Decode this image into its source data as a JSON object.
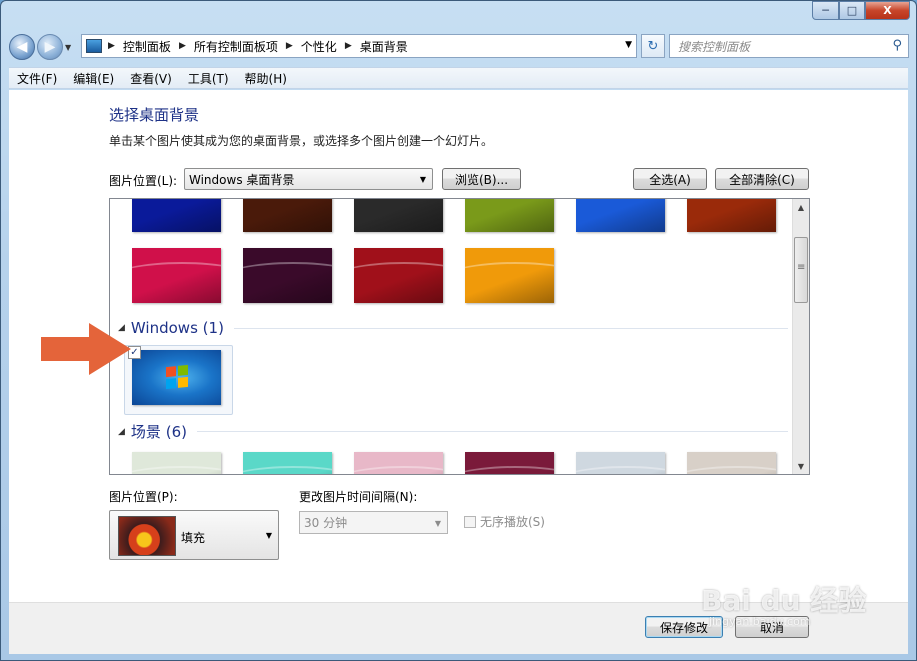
{
  "window": {
    "controls": {
      "minimize": "─",
      "maximize": "□",
      "close": "X"
    }
  },
  "nav": {
    "breadcrumbs": [
      "控制面板",
      "所有控制面板项",
      "个性化",
      "桌面背景"
    ],
    "search_placeholder": "搜索控制面板"
  },
  "menu": [
    "文件(F)",
    "编辑(E)",
    "查看(V)",
    "工具(T)",
    "帮助(H)"
  ],
  "main": {
    "title": "选择桌面背景",
    "description": "单击某个图片使其成为您的桌面背景，或选择多个图片创建一个幻灯片。",
    "location_label": "图片位置(L):",
    "location_value": "Windows 桌面背景",
    "browse_button": "浏览(B)...",
    "select_all_button": "全选(A)",
    "clear_all_button": "全部清除(C)"
  },
  "gallery": {
    "solid_colors": {
      "row1": [
        "#0a1a9a",
        "#4a1a0a",
        "#2a2a2a",
        "#7a9a1a",
        "#1a5ad8",
        "#9a2a0a"
      ],
      "row2": [
        "#d0104a",
        "#3a0a2a",
        "#a0101a",
        "#f09a0a"
      ]
    },
    "groups": [
      {
        "name": "Windows",
        "count": "(1)"
      },
      {
        "name": "场景",
        "count": "(6)"
      }
    ],
    "windows_item_checked": "✓",
    "scene_colors": [
      "#dfe8da",
      "#5ad8c8",
      "#e8b8c8",
      "#7a1a3a",
      "#cfd8e0",
      "#d8d0c8"
    ]
  },
  "bottom": {
    "position_label": "图片位置(P):",
    "position_value": "填充",
    "interval_label": "更改图片时间间隔(N):",
    "interval_value": "30 分钟",
    "shuffle_label": "无序播放(S)"
  },
  "footer": {
    "save_button": "保存修改",
    "cancel_button": "取消"
  },
  "watermark": {
    "text": "Bai du 经验",
    "sub": "jingyan.baidu.com"
  }
}
